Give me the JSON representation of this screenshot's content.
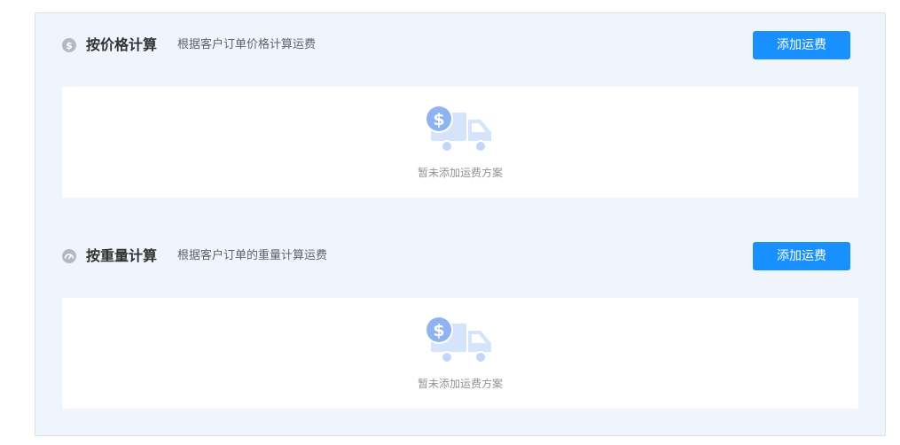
{
  "sections": [
    {
      "icon": "dollar-coin-icon",
      "title": "按价格计算",
      "description": "根据客户订单价格计算运费",
      "add_button": "添加运费",
      "empty_text": "暂未添加运费方案",
      "empty_icon": "delivery-truck-dollar-icon"
    },
    {
      "icon": "weight-gauge-icon",
      "title": "按重量计算",
      "description": "根据客户订单的重量计算运费",
      "add_button": "添加运费",
      "empty_text": "暂未添加运费方案",
      "empty_icon": "delivery-truck-dollar-icon"
    }
  ],
  "colors": {
    "primary_button": "#1890ff",
    "panel_background": "#f0f4fc",
    "icon_gray": "#b3b8c6",
    "illustration_light": "#d6e4fb",
    "illustration_dark": "#8fb3f0"
  }
}
